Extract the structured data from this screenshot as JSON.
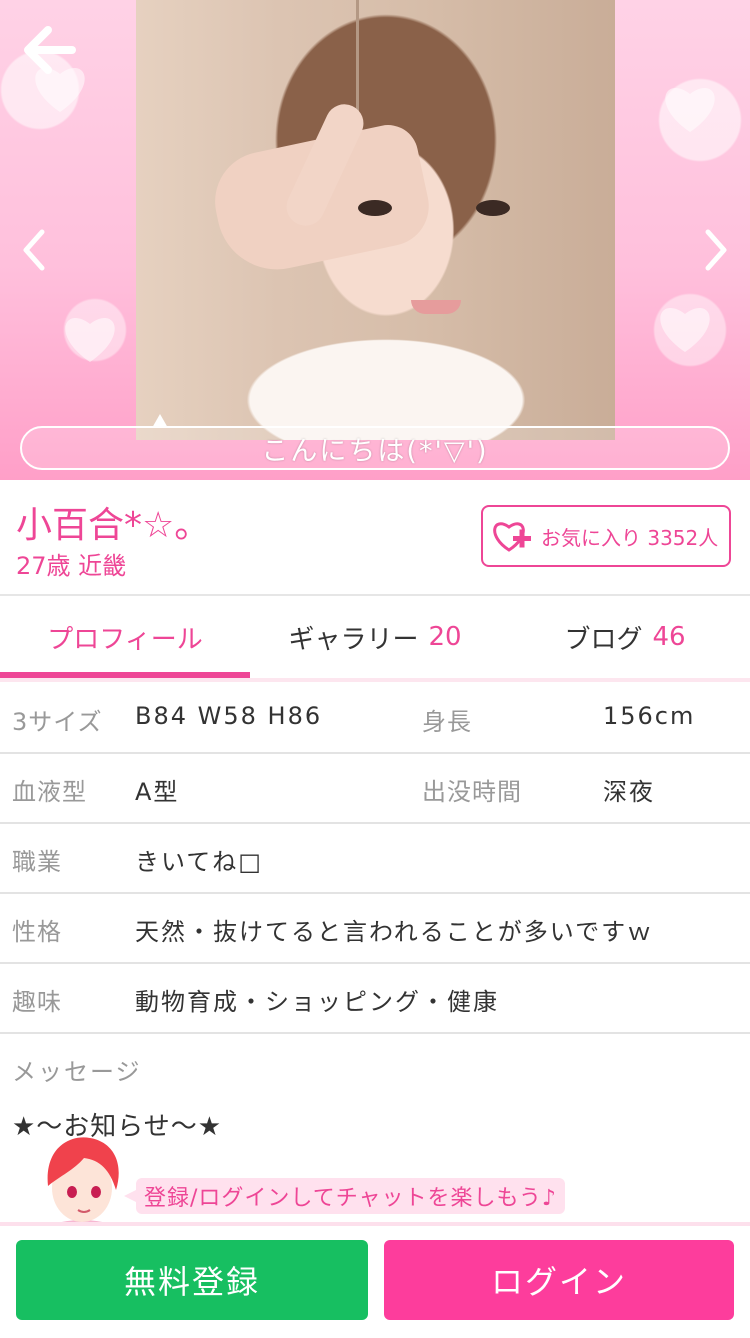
{
  "hero": {
    "greeting": "こんにちは(*'▽')"
  },
  "profile": {
    "name": "小百合*☆。",
    "age_region": "27歳 近畿",
    "favorite_label": "お気に入り 3352人"
  },
  "tabs": [
    {
      "label": "プロフィール",
      "count": ""
    },
    {
      "label": "ギャラリー",
      "count": "20"
    },
    {
      "label": "ブログ",
      "count": "46"
    }
  ],
  "details": {
    "sizes_label": "3サイズ",
    "sizes_value": "B84 W58 H86",
    "height_label": "身長",
    "height_value": "156cm",
    "blood_label": "血液型",
    "blood_value": "A型",
    "time_label": "出没時間",
    "time_value": "深夜",
    "job_label": "職業",
    "job_value": "きいてね□",
    "personality_label": "性格",
    "personality_value": "天然・抜けてると言われることが多いですｗ",
    "hobby_label": "趣味",
    "hobby_value": "動物育成・ショッピング・健康"
  },
  "message": {
    "label": "メッセージ",
    "body": "★〜お知らせ〜★"
  },
  "promo": {
    "text": "登録/ログインしてチャットを楽しもう♪"
  },
  "footer": {
    "register_label": "無料登録",
    "login_label": "ログイン"
  },
  "colors": {
    "accent": "#ee4696",
    "register": "#17bf61",
    "login": "#fd3d9c"
  }
}
